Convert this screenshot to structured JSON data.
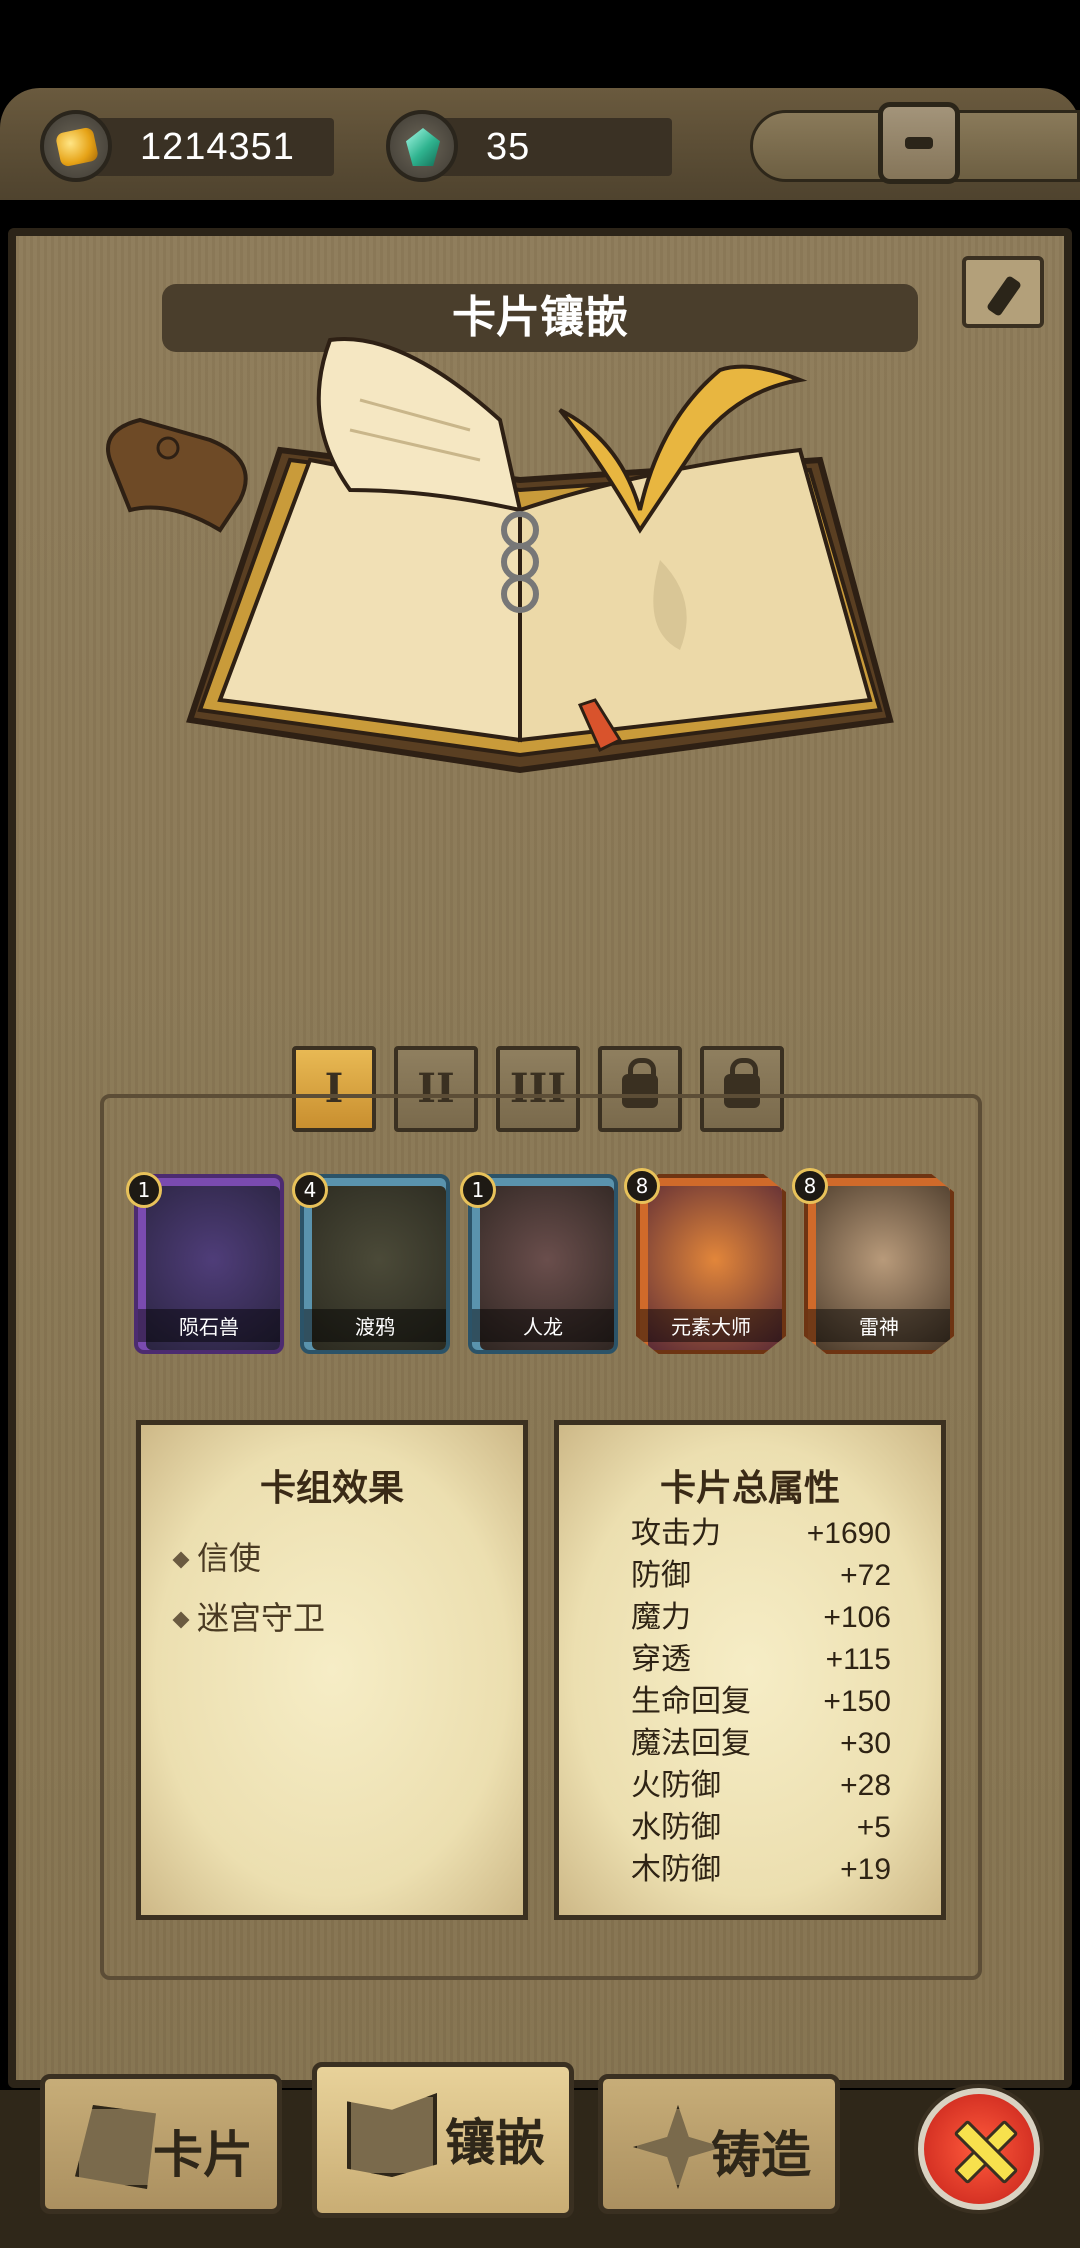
{
  "currency": {
    "gold": "1214351",
    "gems": "35"
  },
  "title": "卡片镶嵌",
  "tabs": [
    "I",
    "II",
    "III"
  ],
  "cards": [
    {
      "name": "陨石兽",
      "level": "1",
      "frame": "purple"
    },
    {
      "name": "渡鸦",
      "level": "4",
      "frame": "blue"
    },
    {
      "name": "人龙",
      "level": "1",
      "frame": "blue"
    },
    {
      "name": "元素大师",
      "level": "8",
      "frame": "orange"
    },
    {
      "name": "雷神",
      "level": "8",
      "frame": "orange"
    }
  ],
  "deck_effects": {
    "title": "卡组效果",
    "items": [
      "信使",
      "迷宫守卫"
    ]
  },
  "card_stats": {
    "title": "卡片总属性",
    "rows": [
      {
        "name": "攻击力",
        "value": "+1690"
      },
      {
        "name": "防御",
        "value": "+72"
      },
      {
        "name": "魔力",
        "value": "+106"
      },
      {
        "name": "穿透",
        "value": "+115"
      },
      {
        "name": "生命回复",
        "value": "+150"
      },
      {
        "name": "魔法回复",
        "value": "+30"
      },
      {
        "name": "火防御",
        "value": "+28"
      },
      {
        "name": "水防御",
        "value": "+5"
      },
      {
        "name": "木防御",
        "value": "+19"
      }
    ]
  },
  "nav": {
    "cards": "卡片",
    "inlay": "镶嵌",
    "forge": "铸造"
  }
}
